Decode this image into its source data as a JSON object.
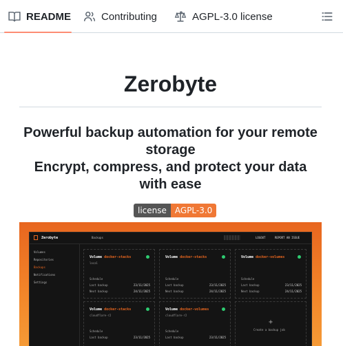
{
  "tabs": [
    {
      "label": "README",
      "icon": "book-icon"
    },
    {
      "label": "Contributing",
      "icon": "people-icon"
    },
    {
      "label": "AGPL-3.0 license",
      "icon": "law-icon"
    }
  ],
  "toc_icon": "list-icon",
  "title": "Zerobyte",
  "subtitle_line1": "Powerful backup automation for your remote",
  "subtitle_line2": "storage",
  "subtitle_line3": "Encrypt, compress, and protect your data",
  "subtitle_line4": "with ease",
  "badge": {
    "label": "license",
    "value": "AGPL-3.0",
    "value_color": "#f07835"
  },
  "screenshot": {
    "app_name": "Zerobyte",
    "breadcrumb": "Backups",
    "logout": "LOGOUT",
    "report": "REPORT AN ISSUE",
    "sidebar": [
      "Volumes",
      "Repositories",
      "Backups",
      "Notifications",
      "Settings"
    ],
    "active_sidebar": "Backups",
    "cards": [
      {
        "prefix": "Volume",
        "name": "docker-stacks",
        "sub": "local",
        "schedule": "",
        "last_backup": "23/11/2025",
        "next_backup": "24/11/2025"
      },
      {
        "prefix": "Volume",
        "name": "docker-stacks",
        "sub": "",
        "schedule": "",
        "last_backup": "23/11/2025",
        "next_backup": "24/11/2025"
      },
      {
        "prefix": "Volume",
        "name": "docker-volumes",
        "sub": "",
        "schedule": "",
        "last_backup": "23/11/2025",
        "next_backup": "24/11/2025"
      },
      {
        "prefix": "Volume",
        "name": "docker-stacks",
        "sub": "cloudflare-r2",
        "schedule": "",
        "last_backup": "23/11/2025",
        "next_backup": ""
      },
      {
        "prefix": "Volume",
        "name": "docker-volumes",
        "sub": "cloudflare-r2",
        "schedule": "",
        "last_backup": "23/11/2025",
        "next_backup": ""
      }
    ],
    "labels": {
      "schedule": "Schedule",
      "last_backup": "Last backup",
      "next_backup": "Next backup"
    },
    "create_label": "Create a backup job"
  }
}
